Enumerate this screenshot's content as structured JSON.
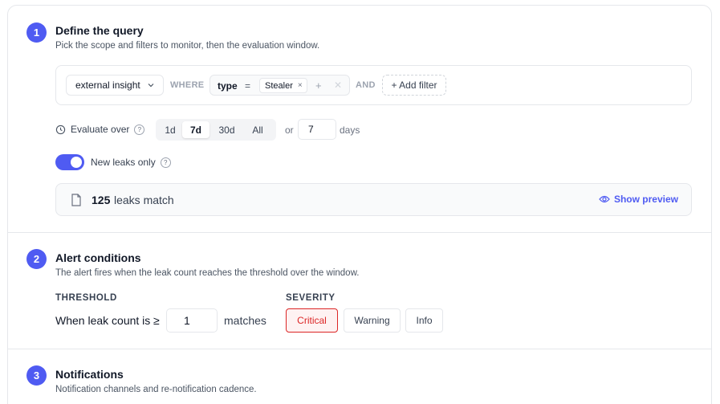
{
  "sections": [
    {
      "number": "1",
      "title": "Define the query",
      "subtitle": "Pick the scope and filters to monitor, then the evaluation window."
    },
    {
      "number": "2",
      "title": "Alert conditions",
      "subtitle": "The alert fires when the leak count reaches the threshold over the window."
    },
    {
      "number": "3",
      "title": "Notifications",
      "subtitle": "Notification channels and re-notification cadence."
    }
  ],
  "query": {
    "source": "external insight",
    "where_kw": "WHERE",
    "filter_field": "type",
    "filter_op": "=",
    "filter_value": "Stealer",
    "filter_add": "+",
    "and_kw": "AND",
    "add_filter": "+ Add filter"
  },
  "evaluate": {
    "label": "Evaluate over",
    "options": [
      "1d",
      "7d",
      "30d",
      "All"
    ],
    "selected": "7d",
    "or_label": "or",
    "custom_value": "7",
    "unit": "days"
  },
  "new_leaks": {
    "label": "New leaks only",
    "enabled": true
  },
  "match": {
    "count": "125",
    "suffix": "leaks match",
    "preview": "Show preview"
  },
  "threshold": {
    "header": "THRESHOLD",
    "label": "When leak count is",
    "operator": "≥",
    "value": "1",
    "unit": "matches"
  },
  "severity": {
    "header": "SEVERITY",
    "options": [
      "Critical",
      "Warning",
      "Info"
    ],
    "selected": "Critical"
  },
  "colors": {
    "accent": "#4f5bf2",
    "critical": "#dc2626"
  }
}
